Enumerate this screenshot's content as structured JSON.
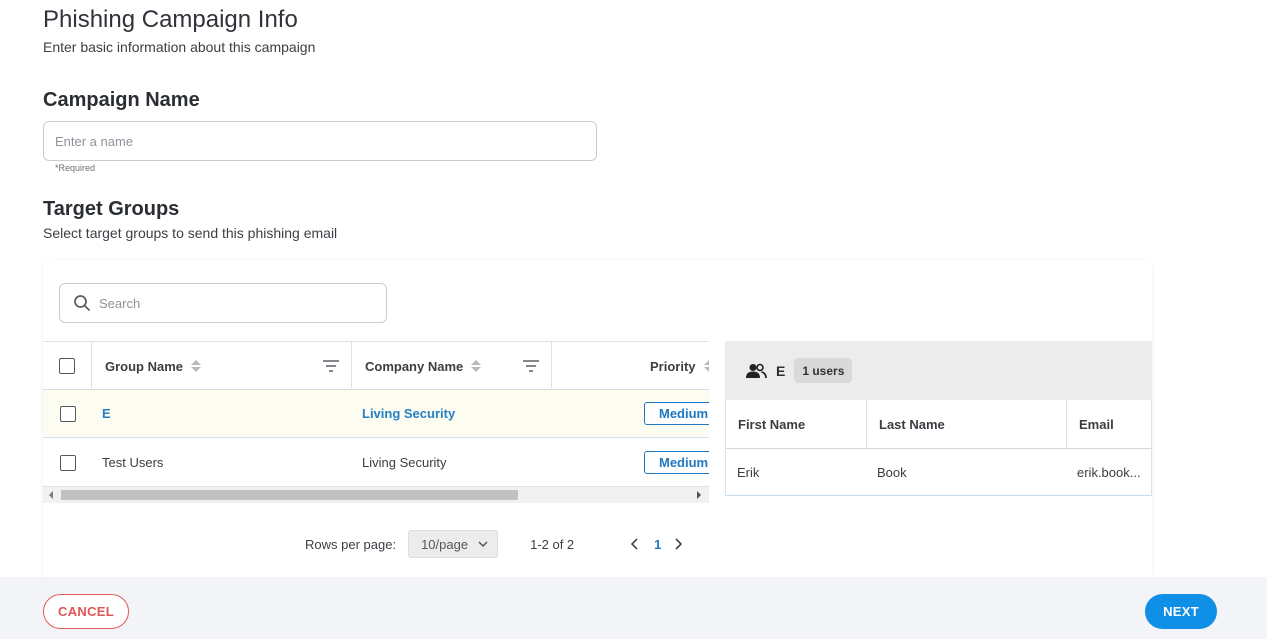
{
  "header": {
    "title": "Phishing Campaign Info",
    "subtitle": "Enter basic information about this campaign"
  },
  "campaign_name": {
    "title": "Campaign Name",
    "placeholder": "Enter a name",
    "value": "",
    "required_note": "*Required"
  },
  "target_groups": {
    "title": "Target Groups",
    "subtitle": "Select target groups to send this phishing email",
    "search": {
      "placeholder": "Search",
      "value": ""
    },
    "columns": [
      "Group Name",
      "Company Name",
      "Priority"
    ],
    "rows": [
      {
        "group": "E",
        "company": "Living Security",
        "priority": "Medium",
        "selected": true
      },
      {
        "group": "Test Users",
        "company": "Living Security",
        "priority": "Medium",
        "selected": false
      }
    ],
    "pagination": {
      "rows_label": "Rows per page:",
      "rows_value": "10/page",
      "range": "1-2 of 2",
      "current_page": "1"
    }
  },
  "group_detail": {
    "group_name": "E",
    "users_badge": "1 users",
    "columns": [
      "First Name",
      "Last Name",
      "Email"
    ],
    "rows": [
      {
        "first": "Erik",
        "last": "Book",
        "email": "erik.book..."
      }
    ]
  },
  "footer": {
    "cancel_label": "CANCEL",
    "next_label": "NEXT"
  },
  "colors": {
    "link": "#2481c6",
    "accent": "#0f8fe6",
    "cancel": "#e05555",
    "selected_row": "#fcfcf1",
    "footer_bg": "#f2f4f7"
  },
  "icons": [
    "search-icon",
    "sort-icon",
    "filter-icon",
    "users-icon",
    "chevron-down-icon",
    "chevron-left-icon",
    "chevron-right-icon"
  ]
}
